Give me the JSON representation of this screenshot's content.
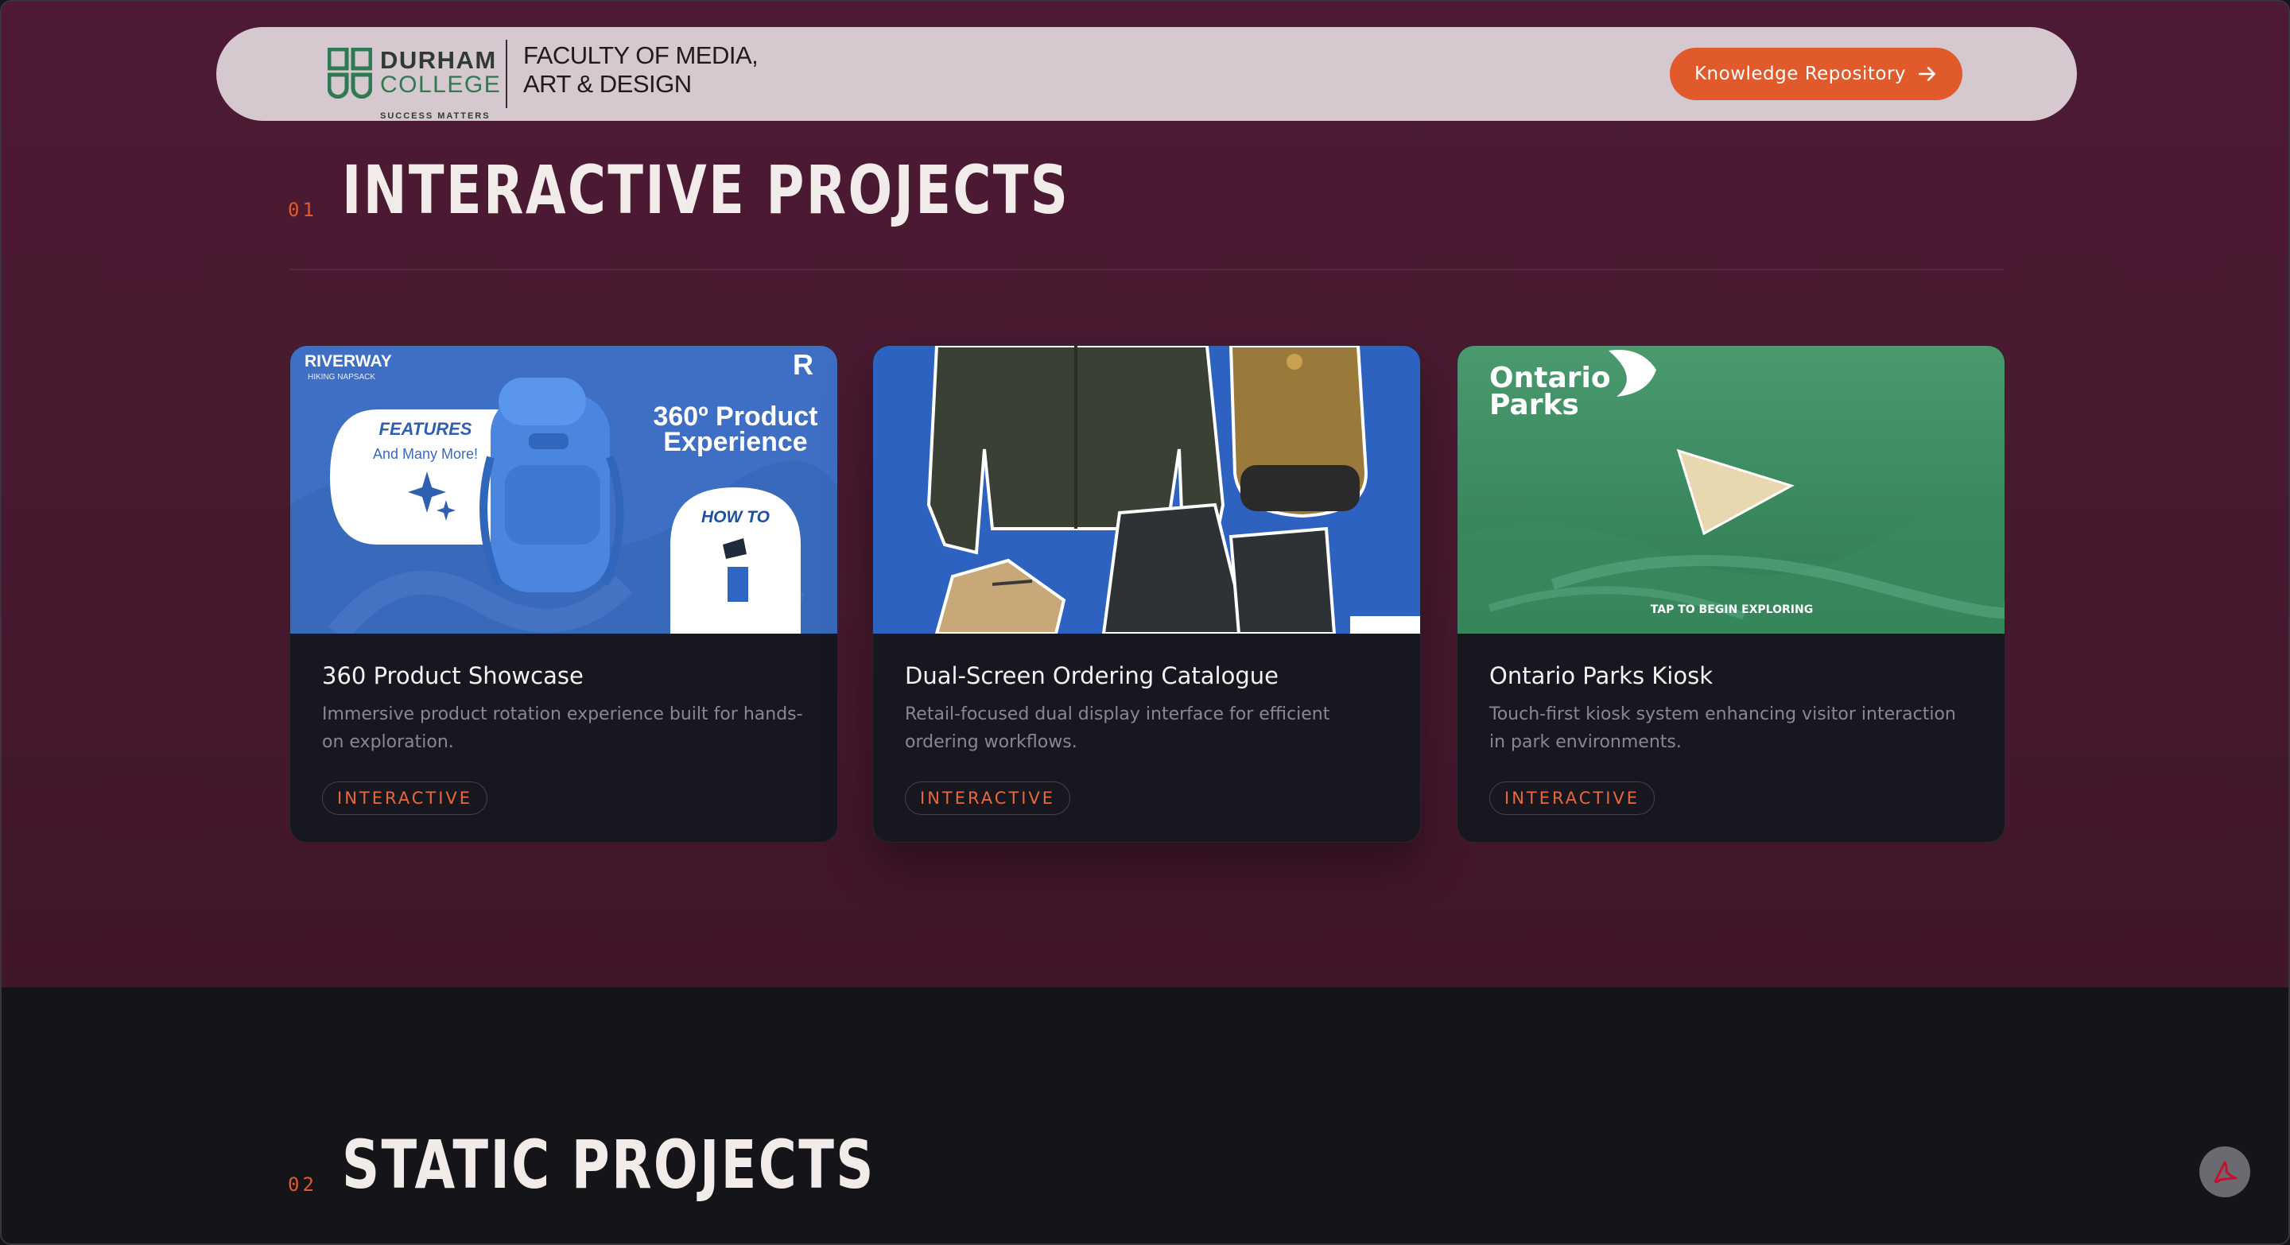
{
  "header": {
    "college_name_line1": "DURHAM",
    "college_name_line2": "COLLEGE",
    "college_tagline": "SUCCESS MATTERS",
    "faculty_line1": "FACULTY OF MEDIA,",
    "faculty_line2": "ART & DESIGN",
    "cta_label": "Knowledge Repository"
  },
  "sections": [
    {
      "number": "01",
      "title": "INTERACTIVE PROJECTS"
    },
    {
      "number": "02",
      "title": "STATIC PROJECTS"
    }
  ],
  "cards": [
    {
      "title": "360 Product Showcase",
      "description": "Immersive product rotation experience built for hands-on exploration.",
      "tag": "INTERACTIVE",
      "image": {
        "brand": "RIVERWAY",
        "brand_sub": "HIKING NAPSACK",
        "features_heading": "FEATURES",
        "features_sub": "And Many More!",
        "experience_line1": "360º Product",
        "experience_line2": "Experience",
        "howto": "HOW TO",
        "corner_letter": "R"
      }
    },
    {
      "title": "Dual-Screen Ordering Catalogue",
      "description": "Retail-focused dual display interface for efficient ordering workflows.",
      "tag": "INTERACTIVE"
    },
    {
      "title": "Ontario Parks Kiosk",
      "description": "Touch-first kiosk system enhancing visitor interaction in park environments.",
      "tag": "INTERACTIVE",
      "image": {
        "brand_line1": "Ontario",
        "brand_line2": "Parks",
        "prompt": "TAP TO BEGIN EXPLORING"
      }
    }
  ],
  "colors": {
    "accent": "#e05a2b",
    "hero_bg": "#4a1a30",
    "dark_bg": "#141419",
    "card_bg": "#17171f",
    "header_bg": "#d6c8cf"
  },
  "icons": {
    "cta_icon": "arrow-right-icon",
    "floating_button": "pdf-icon"
  }
}
